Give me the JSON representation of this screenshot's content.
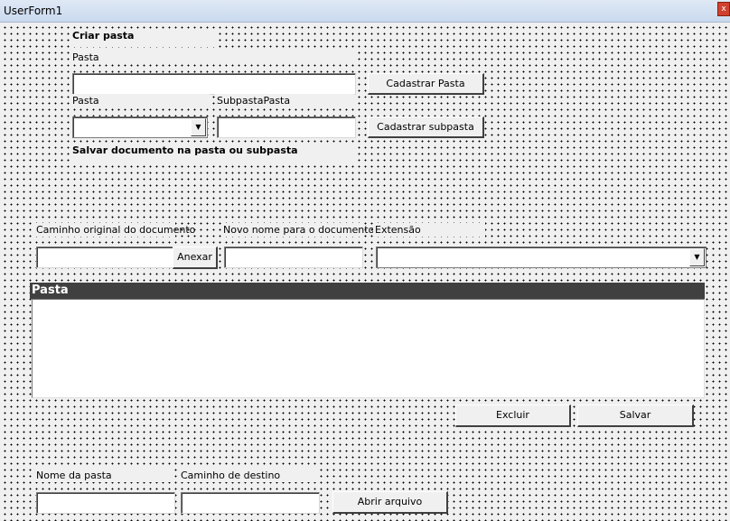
{
  "window": {
    "title": "UserForm1",
    "close_glyph": "x"
  },
  "criar": {
    "heading": "Criar pasta",
    "pasta_label": "Pasta",
    "pasta_value": "",
    "cadastrar_pasta_button": "Cadastrar Pasta",
    "pasta_combo_label": "Pasta",
    "pasta_combo_value": "",
    "subpasta_label": "SubpastaPasta",
    "subpasta_value": "",
    "cadastrar_subpasta_button": "Cadastrar subpasta"
  },
  "salvar": {
    "heading": "Salvar documento na pasta ou subpasta",
    "caminho_label": "Caminho original do documento",
    "caminho_value": "",
    "anexar_button": "Anexar",
    "novo_nome_label": "Novo nome para o documento",
    "novo_nome_value": "",
    "extensao_label": "Extensão",
    "extensao_value": ""
  },
  "list": {
    "header": "Pasta",
    "items": []
  },
  "actions": {
    "excluir_button": "Excluir",
    "salvar_button": "Salvar"
  },
  "bottom": {
    "nome_pasta_label": "Nome da pasta",
    "nome_pasta_value": "",
    "caminho_destino_label": "Caminho de destino",
    "caminho_destino_value": "",
    "abrir_button": "Abrir arquivo"
  },
  "icons": {
    "dropdown_arrow": "chevron-down-icon",
    "close": "close-icon"
  }
}
